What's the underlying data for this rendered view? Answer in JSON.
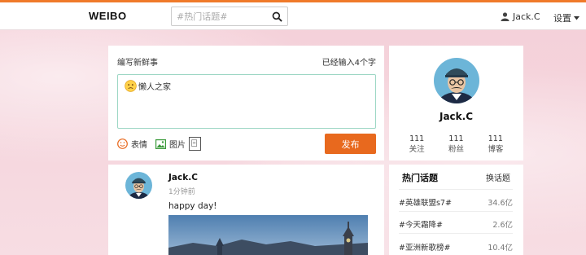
{
  "nav": {
    "logo": "WEIBO",
    "search_placeholder": "#热门话题#",
    "user_name": "Jack.C",
    "settings_label": "设置"
  },
  "compose": {
    "title": "编写新鲜事",
    "char_count": "已经输入4个字",
    "text": "懒人之家",
    "emoji_label": "表情",
    "image_label": "图片",
    "publish_label": "发布"
  },
  "profile": {
    "name": "Jack.C",
    "stats": [
      {
        "num": "111",
        "label": "关注"
      },
      {
        "num": "111",
        "label": "粉丝"
      },
      {
        "num": "111",
        "label": "博客"
      }
    ]
  },
  "post": {
    "author": "Jack.C",
    "time": "1分钟前",
    "text": "happy day!"
  },
  "topics": {
    "title": "热门话题",
    "swap_label": "换话题",
    "items": [
      {
        "name": "#英雄联盟s7#",
        "value": "34.6亿"
      },
      {
        "name": "#今天霜降#",
        "value": "2.6亿"
      },
      {
        "name": "#亚洲新歌榜#",
        "value": "10.4亿"
      }
    ]
  },
  "colors": {
    "accent": "#e8691e",
    "top_line": "#f07a2a",
    "textbox_border": "#9dd7c5"
  }
}
